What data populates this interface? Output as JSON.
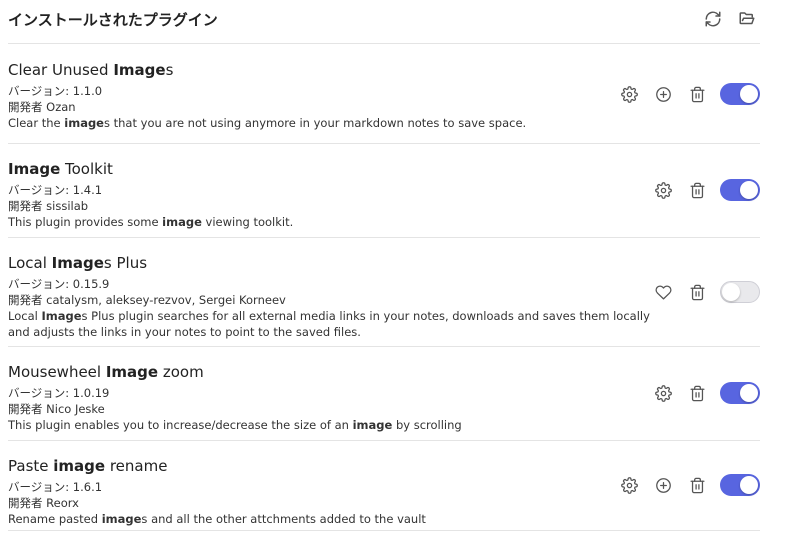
{
  "header": {
    "title": "インストールされたプラグイン",
    "reload_icon": "reload-icon",
    "folder_icon": "folder-icon"
  },
  "colors": {
    "accent": "#5865e0",
    "toggle_off": "#e9e9ec",
    "divider": "#e4e4e4",
    "icon": "#555555"
  },
  "plugins": [
    {
      "name": [
        "Clear Unused ",
        "Image",
        "s"
      ],
      "version": "バージョン: 1.1.0",
      "author": "開発者 Ozan",
      "desc_lines": [
        [
          "Clear the ",
          "image",
          "s that you are not using anymore in your markdown notes to save space."
        ]
      ],
      "buttons": [
        "gear-icon",
        "plus-circle-icon",
        "trash-icon"
      ],
      "enabled": true
    },
    {
      "name": [
        "",
        "Image",
        " Toolkit"
      ],
      "version": "バージョン: 1.4.1",
      "author": "開発者 sissilab",
      "desc_lines": [
        [
          "This plugin provides some ",
          "image",
          " viewing toolkit."
        ]
      ],
      "buttons": [
        "gear-icon",
        "trash-icon"
      ],
      "enabled": true
    },
    {
      "name": [
        "Local ",
        "Image",
        "s Plus"
      ],
      "version": "バージョン: 0.15.9",
      "author": "開発者 catalysm, aleksey-rezvov, Sergei Korneev",
      "desc_lines": [
        [
          "Local ",
          "Image",
          "s Plus plugin searches for all external media links in your notes, downloads and saves them locally"
        ],
        [
          "and adjusts the links in your notes to point to the saved files.",
          "",
          ""
        ]
      ],
      "buttons": [
        "heart-icon",
        "trash-icon"
      ],
      "enabled": false
    },
    {
      "name": [
        "Mousewheel ",
        "Image",
        " zoom"
      ],
      "version": "バージョン: 1.0.19",
      "author": "開発者 Nico Jeske",
      "desc_lines": [
        [
          "This plugin enables you to increase/decrease the size of an ",
          "image",
          " by scrolling"
        ]
      ],
      "buttons": [
        "gear-icon",
        "trash-icon"
      ],
      "enabled": true
    },
    {
      "name": [
        "Paste ",
        "image",
        " rename"
      ],
      "version": "バージョン: 1.6.1",
      "author": "開発者 Reorx",
      "desc_lines": [
        [
          "Rename pasted ",
          "image",
          "s and all the other attchments added to the vault"
        ]
      ],
      "buttons": [
        "gear-icon",
        "plus-circle-icon",
        "trash-icon"
      ],
      "enabled": true
    }
  ]
}
